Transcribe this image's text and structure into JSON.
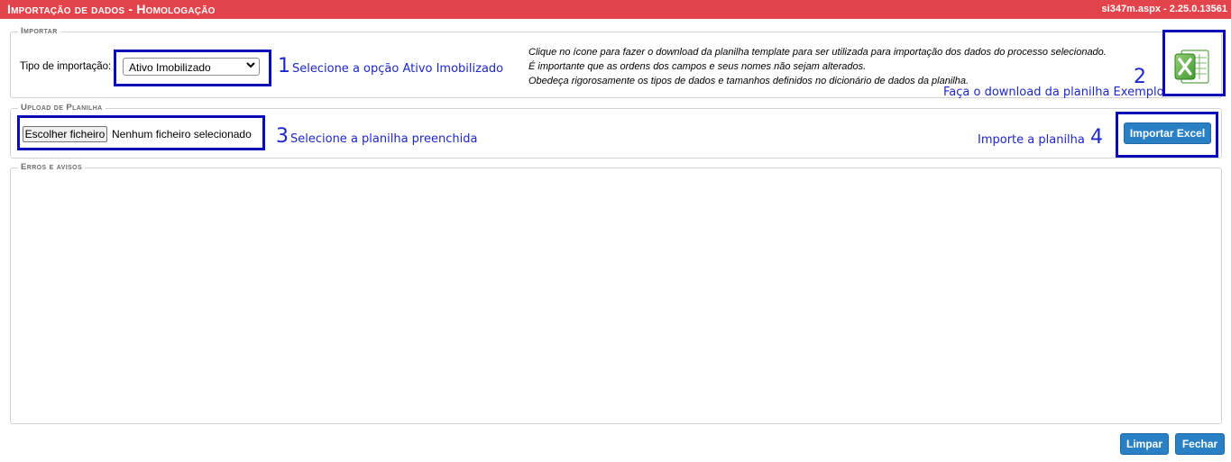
{
  "header": {
    "title": "Importação de dados  - Homologação",
    "version": "si347m.aspx - 2.25.0.13561"
  },
  "importar": {
    "legend": "Importar",
    "tipo_label": "Tipo de importação:",
    "tipo_selected": "Ativo Imobilizado",
    "info_lines": [
      "Clique no ícone para fazer o download da planilha template para ser utilizada para importação dos dados do processo selecionado.",
      "É importante que as ordens dos campos e seus nomes não sejam alterados.",
      "Obedeça rigorosamente os tipos de dados e tamanhos definidos no dicionário de dados da planilha."
    ],
    "excel_icon": "excel-icon"
  },
  "upload": {
    "legend": "Upload de Planilha",
    "choose_label": "Escolher ficheiro",
    "no_file": "Nenhum ficheiro selecionado",
    "import_button": "Importar Excel"
  },
  "erros": {
    "legend": "Erros e avisos"
  },
  "footer": {
    "limpar": "Limpar",
    "fechar": "Fechar"
  },
  "annotations": {
    "n1": "1",
    "t1": "Selecione a opção Ativo Imobilizado",
    "n2": "2",
    "t2": "Faça o download da planilha Exemplo",
    "n3": "3",
    "t3": "Selecione a planilha preenchida",
    "n4": "4",
    "t4": "Importe a planilha",
    "color": "#1d27c9"
  },
  "colors": {
    "header_bg": "#e3434b",
    "button_bg": "#2a80c5",
    "highlight": "#0a0ab8"
  }
}
